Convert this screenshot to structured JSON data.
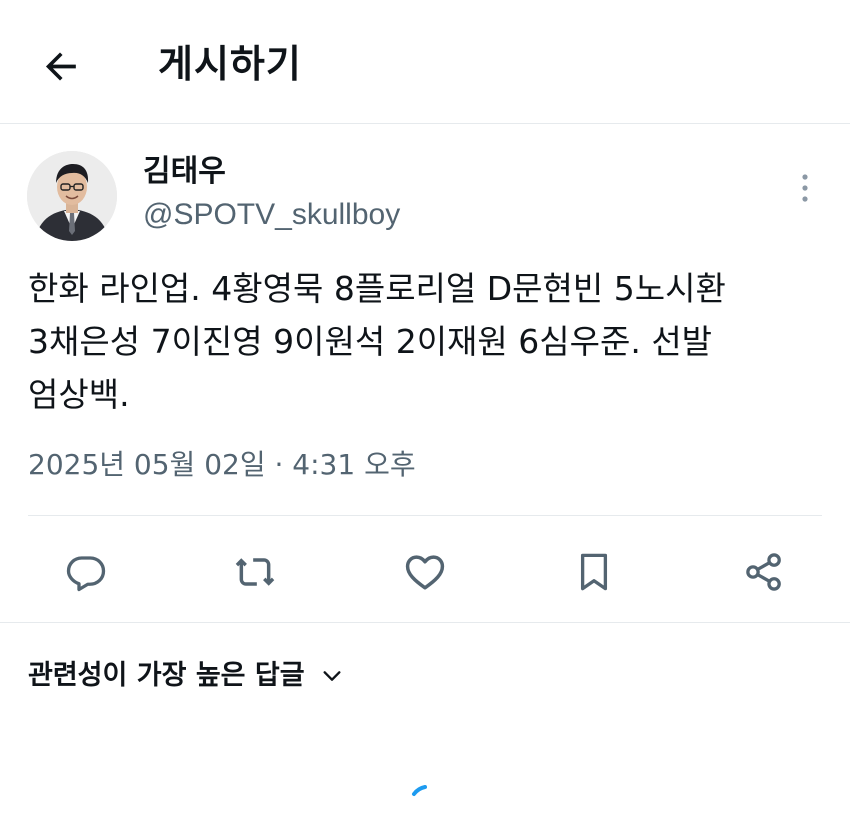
{
  "header": {
    "title": "게시하기",
    "back_icon": "arrow-left-icon"
  },
  "author": {
    "name": "김태우",
    "handle": "@SPOTV_skullboy",
    "avatar_icon": "avatar-photo"
  },
  "post": {
    "text": "한화 라인업. 4황영묵 8플로리얼 D문현빈 5노시환\n3채은성 7이진영 9이원석 2이재원 6심우준. 선발\n엄상백.",
    "timestamp": "2025년 05월 02일 · 4:31 오후"
  },
  "actions": [
    {
      "icon": "reply-icon"
    },
    {
      "icon": "repost-icon"
    },
    {
      "icon": "like-icon"
    },
    {
      "icon": "bookmark-icon"
    },
    {
      "icon": "share-icon"
    }
  ],
  "replies": {
    "sort_label": "관련성이 가장 높은 답글",
    "sort_icon": "chevron-down-icon"
  },
  "colors": {
    "text_primary": "#0f1419",
    "text_secondary": "#536471",
    "divider": "#e6eaed",
    "icon": "#536471",
    "accent": "#1d9bf0"
  }
}
